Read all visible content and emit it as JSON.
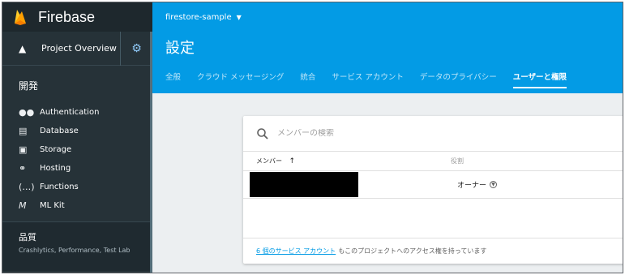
{
  "app": {
    "brand": "Firebase"
  },
  "sidebar": {
    "overview_label": "Project Overview",
    "section_title": "開発",
    "items": [
      {
        "label": "Authentication",
        "icon": "people-icon"
      },
      {
        "label": "Database",
        "icon": "database-icon"
      },
      {
        "label": "Storage",
        "icon": "folder-icon"
      },
      {
        "label": "Hosting",
        "icon": "hosting-icon"
      },
      {
        "label": "Functions",
        "icon": "functions-icon"
      },
      {
        "label": "ML Kit",
        "icon": "mlkit-icon"
      }
    ],
    "quality": {
      "title": "品質",
      "subtitle": "Crashlytics, Performance, Test Lab"
    }
  },
  "header": {
    "project_name": "firestore-sample",
    "page_title": "設定",
    "tabs": [
      {
        "label": "全般",
        "active": false
      },
      {
        "label": "クラウド メッセージング",
        "active": false
      },
      {
        "label": "統合",
        "active": false
      },
      {
        "label": "サービス アカウント",
        "active": false
      },
      {
        "label": "データのプライバシー",
        "active": false
      },
      {
        "label": "ユーザーと権限",
        "active": true
      }
    ]
  },
  "members": {
    "search_placeholder": "メンバーの検索",
    "col_member": "メンバー",
    "col_role": "役割",
    "rows": [
      {
        "role": "オーナー"
      }
    ],
    "footer_link": "6 個のサービス アカウント",
    "footer_text": "もこのプロジェクトへのアクセス権を持っています"
  },
  "colors": {
    "header_blue": "#039be5",
    "sidebar_dark": "#263238",
    "link": "#039be5"
  }
}
